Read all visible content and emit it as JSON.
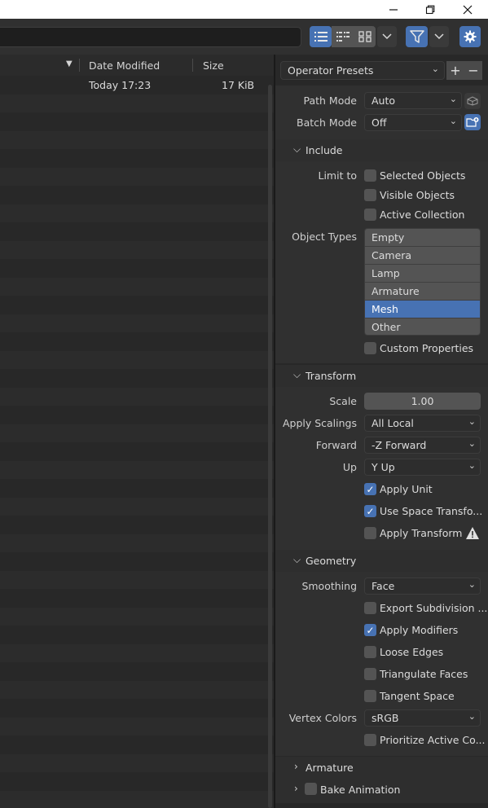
{
  "window": {
    "minimize_icon": "minimize-icon",
    "restore_icon": "restore-icon",
    "close_icon": "close-icon"
  },
  "toolbar": {
    "path_value": "",
    "display_modes": [
      "vertical-list-icon",
      "horizontal-list-icon",
      "thumbnails-icon"
    ],
    "filter_icon": "filter-icon",
    "settings_icon": "gear-icon"
  },
  "file_browser": {
    "columns": {
      "date": "Date Modified",
      "size": "Size"
    },
    "sort_indicator": "▼",
    "files": [
      {
        "date": "Today 17:23",
        "size": "17 KiB"
      }
    ]
  },
  "panel": {
    "operator_presets": "Operator Presets",
    "add_label": "+",
    "remove_label": "−",
    "path_mode": {
      "label": "Path Mode",
      "value": "Auto"
    },
    "batch_mode": {
      "label": "Batch Mode",
      "value": "Off"
    },
    "include": {
      "title": "Include",
      "limit_to_label": "Limit to",
      "selected_objects": "Selected Objects",
      "visible_objects": "Visible Objects",
      "active_collection": "Active Collection",
      "object_types_label": "Object Types",
      "object_types": [
        "Empty",
        "Camera",
        "Lamp",
        "Armature",
        "Mesh",
        "Other"
      ],
      "selected_type": "Mesh",
      "custom_properties": "Custom Properties"
    },
    "transform": {
      "title": "Transform",
      "scale_label": "Scale",
      "scale_value": "1.00",
      "apply_scalings_label": "Apply Scalings",
      "apply_scalings_value": "All Local",
      "forward_label": "Forward",
      "forward_value": "-Z Forward",
      "up_label": "Up",
      "up_value": "Y Up",
      "apply_unit": "Apply Unit",
      "use_space_transform": "Use Space Transfo...",
      "apply_transform": "Apply Transform"
    },
    "geometry": {
      "title": "Geometry",
      "smoothing_label": "Smoothing",
      "smoothing_value": "Face",
      "export_subdivision": "Export Subdivision ...",
      "apply_modifiers": "Apply Modifiers",
      "loose_edges": "Loose Edges",
      "triangulate_faces": "Triangulate Faces",
      "tangent_space": "Tangent Space",
      "vertex_colors_label": "Vertex Colors",
      "vertex_colors_value": "sRGB",
      "prioritize_active": "Prioritize Active Co..."
    },
    "armature": {
      "title": "Armature"
    },
    "bake_animation": {
      "title": "Bake Animation"
    }
  },
  "colors": {
    "accent": "#4772b3",
    "background": "#1d1d1d",
    "panel": "#303030"
  }
}
